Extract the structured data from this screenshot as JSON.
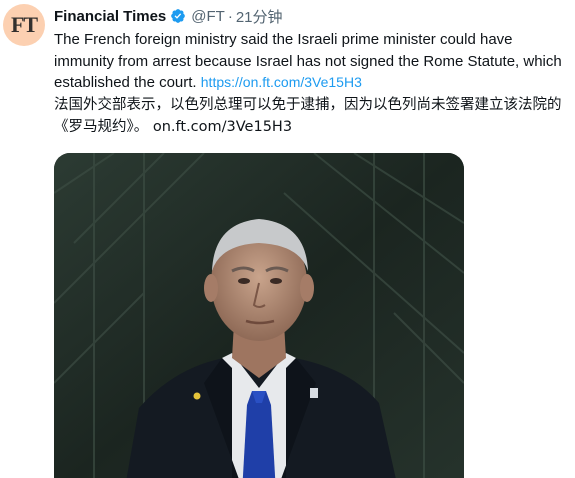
{
  "tweet": {
    "avatar": {
      "initials": "FT",
      "background": "#fcd0b1"
    },
    "author": {
      "name": "Financial Times",
      "handle": "@FT",
      "separator": "·",
      "time": "21分钟",
      "verified": true,
      "verified_icon": "verified-badge-icon",
      "verified_color": "#1d9bf0"
    },
    "text_en": "The French foreign ministry said the Israeli prime minister could have immunity from arrest because Israel has not signed the Rome Statute, which established the court.",
    "link_en": "https://on.ft.com/3Ve15H3",
    "text_zh": "法国外交部表示，以色列总理可以免于逮捕，因为以色列尚未签署建立该法院的《罗马规约》。",
    "link_zh": "on.ft.com/3Ve15H3",
    "link_color": "#1d9bf0"
  }
}
